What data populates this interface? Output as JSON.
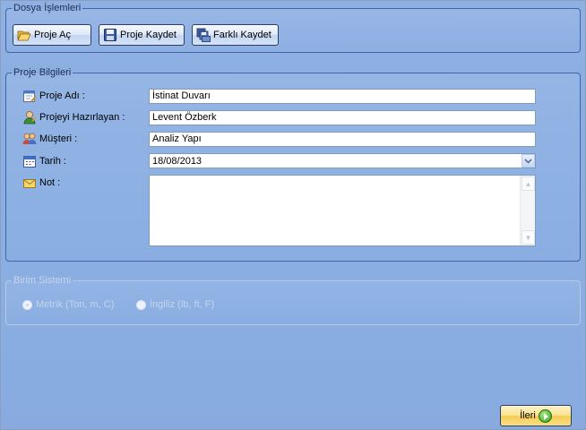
{
  "dosya": {
    "legend": "Dosya İşlemleri",
    "buttons": [
      {
        "label": "Proje Aç",
        "icon": "folder-open-icon"
      },
      {
        "label": "Proje Kaydet",
        "icon": "floppy-disk-icon"
      },
      {
        "label": "Farklı Kaydet",
        "icon": "save-as-icon"
      }
    ]
  },
  "proje": {
    "legend": "Proje Bilgileri",
    "fields": {
      "proje_adi": {
        "label": "Proje Adı :",
        "value": "İstinat Duvarı",
        "icon": "calendar-edit-icon"
      },
      "hazirlayan": {
        "label": "Projeyi Hazırlayan :",
        "value": "Levent Özberk",
        "icon": "user-icon"
      },
      "musteri": {
        "label": "Müşteri :",
        "value": "Analiz Yapı",
        "icon": "users-icon"
      },
      "tarih": {
        "label": "Tarih :",
        "value": "18/08/2013",
        "icon": "calendar-icon"
      },
      "not": {
        "label": "Not :",
        "value": "",
        "icon": "note-icon"
      }
    }
  },
  "birim": {
    "legend": "Birim Sistemi",
    "options": [
      {
        "label": "Metrik (Ton, m, C)",
        "selected": true
      },
      {
        "label": "İngiliz (lb, ft, F)",
        "selected": false
      }
    ]
  },
  "footer": {
    "next_label": "İleri"
  },
  "colors": {
    "panel": "#8aaee2",
    "border": "#3f64a8",
    "next_button": "#f6cd55"
  }
}
